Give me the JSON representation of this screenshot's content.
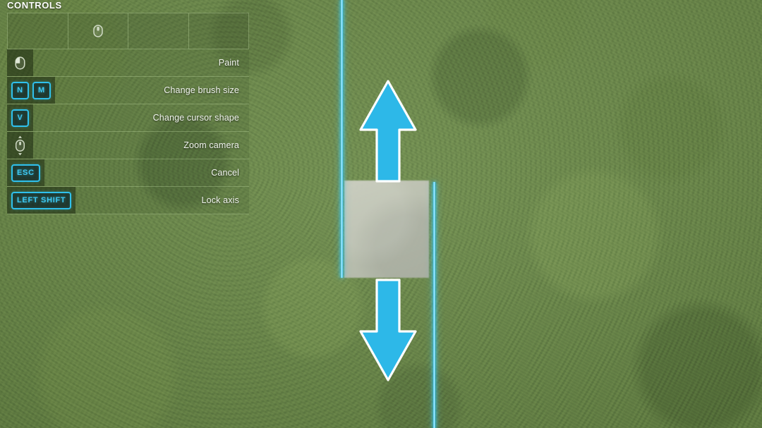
{
  "panel": {
    "title": "CONTROLS",
    "top_strip_cells": [
      {
        "icon": "",
        "name": "cell-1"
      },
      {
        "icon": "mouse-scroll-icon",
        "name": "cell-2"
      },
      {
        "icon": "",
        "name": "cell-3"
      },
      {
        "icon": "",
        "name": "cell-4"
      }
    ],
    "rows": [
      {
        "icon": "mouse-left-button-icon",
        "keys": [],
        "label": "Paint"
      },
      {
        "icon": "",
        "keys": [
          "N",
          "M"
        ],
        "label": "Change brush size"
      },
      {
        "icon": "",
        "keys": [
          "V"
        ],
        "label": "Change cursor shape"
      },
      {
        "icon": "mouse-scroll-zoom-icon",
        "keys": [],
        "label": "Zoom camera"
      },
      {
        "icon": "",
        "keys": [
          "ESC"
        ],
        "label": "Cancel"
      },
      {
        "icon": "",
        "keys": [
          "LEFT SHIFT"
        ],
        "label": "Lock axis"
      }
    ]
  },
  "viewport": {
    "terrain": "grass",
    "painted_patch": "concrete-square",
    "axis_lock_indicator": "vertical",
    "arrows": [
      {
        "name": "arrow-up-indicator",
        "direction": "up"
      },
      {
        "name": "arrow-down-indicator",
        "direction": "down"
      }
    ],
    "guide_lines": [
      {
        "name": "axis-line-left",
        "orientation": "vertical"
      },
      {
        "name": "axis-line-right",
        "orientation": "vertical"
      }
    ]
  },
  "colors": {
    "accent_cyan": "#2fc0ec",
    "arrow_fill": "#2db8e8",
    "arrow_outline": "#ffffff",
    "grass": "#6c8a4a",
    "patch": "#bfc3b5",
    "text": "#f2f5ef"
  }
}
